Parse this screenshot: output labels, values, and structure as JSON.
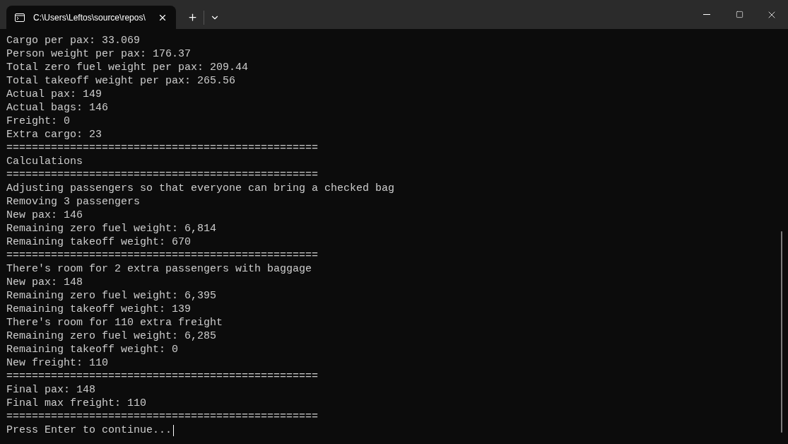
{
  "tab": {
    "title": "C:\\Users\\Leftos\\source\\repos\\",
    "selected": true
  },
  "lines": [
    "Cargo per pax: 33.069",
    "Person weight per pax: 176.37",
    "Total zero fuel weight per pax: 209.44",
    "Total takeoff weight per pax: 265.56",
    "Actual pax: 149",
    "Actual bags: 146",
    "Freight: 0",
    "Extra cargo: 23",
    "=================================================",
    "Calculations",
    "=================================================",
    "Adjusting passengers so that everyone can bring a checked bag",
    "Removing 3 passengers",
    "New pax: 146",
    "Remaining zero fuel weight: 6,814",
    "Remaining takeoff weight: 670",
    "=================================================",
    "There's room for 2 extra passengers with baggage",
    "New pax: 148",
    "Remaining zero fuel weight: 6,395",
    "Remaining takeoff weight: 139",
    "There's room for 110 extra freight",
    "Remaining zero fuel weight: 6,285",
    "Remaining takeoff weight: 0",
    "New freight: 110",
    "=================================================",
    "Final pax: 148",
    "Final max freight: 110",
    "=================================================",
    "Press Enter to continue..."
  ]
}
